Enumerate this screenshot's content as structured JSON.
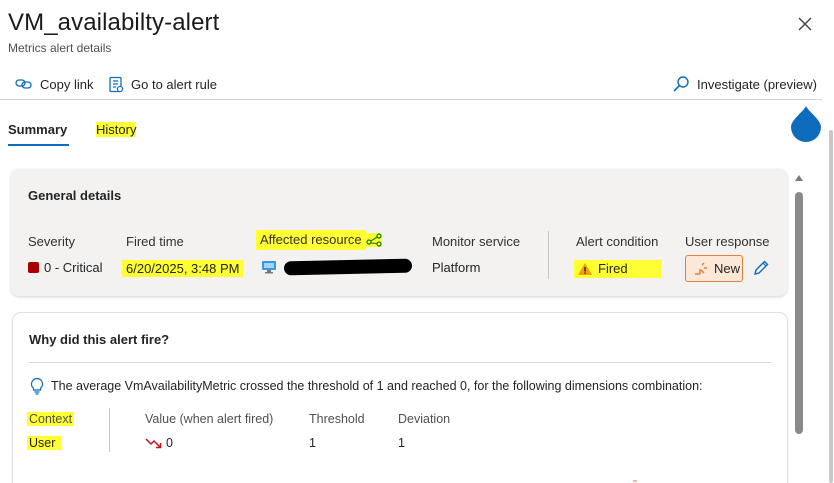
{
  "header": {
    "title": "VM_availabilty-alert",
    "subtitle": "Metrics alert details",
    "close_icon": "close-icon"
  },
  "toolbar": {
    "copy_link": "Copy link",
    "go_to_alert_rule": "Go to alert rule",
    "investigate": "Investigate (preview)"
  },
  "tabs": [
    {
      "label": "Summary",
      "selected": true
    },
    {
      "label": "History",
      "selected": false
    }
  ],
  "general": {
    "title": "General details",
    "columns": {
      "severity": {
        "label": "Severity",
        "value": "0 - Critical",
        "color": "#a80000"
      },
      "fired_time": {
        "label": "Fired time",
        "value": "6/20/2025, 3:48 PM"
      },
      "affected_resource": {
        "label": "Affected resource",
        "value": "",
        "icon": "virtual-machine-icon"
      },
      "monitor_service": {
        "label": "Monitor service",
        "value": "Platform"
      },
      "alert_condition": {
        "label": "Alert condition",
        "value": "Fired",
        "icon": "warning-icon"
      },
      "user_response": {
        "label": "User response",
        "value": "New"
      }
    }
  },
  "why": {
    "title": "Why did this alert fire?",
    "description": "The average VmAvailabilityMetric crossed the threshold of 1 and reached 0, for the following dimensions combination:",
    "headers": {
      "context": "Context",
      "value": "Value (when alert fired)",
      "threshold": "Threshold",
      "deviation": "Deviation"
    },
    "row": {
      "context": "User",
      "value": "0",
      "threshold": "1",
      "deviation": "1"
    }
  },
  "colors": {
    "accent": "#0f6cbd",
    "highlight": "#ffff33",
    "critical": "#a80000",
    "warning": "#f2a100",
    "new_badge_border": "#e0823d"
  }
}
